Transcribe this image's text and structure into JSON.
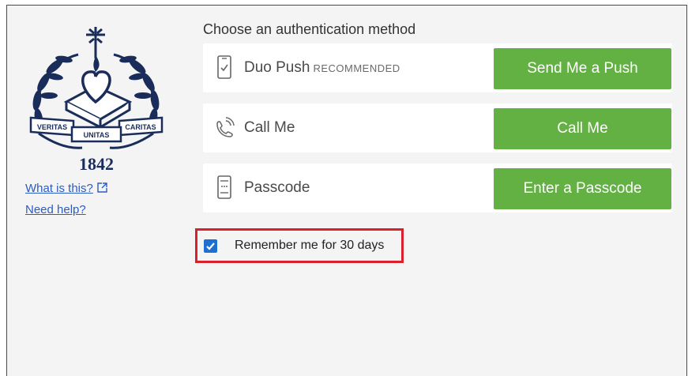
{
  "prompt": {
    "heading": "Choose an authentication method"
  },
  "logo": {
    "banner_left": "VERITAS",
    "banner_center": "UNITAS",
    "banner_right": "CARITAS",
    "year": "1842"
  },
  "side_links": {
    "what_is_this": "What is this?",
    "need_help": "Need help?"
  },
  "methods": [
    {
      "label": "Duo Push",
      "tag": "RECOMMENDED",
      "icon": "phone-push-icon",
      "button": "Send Me a Push"
    },
    {
      "label": "Call Me",
      "tag": "",
      "icon": "phone-call-icon",
      "button": "Call Me"
    },
    {
      "label": "Passcode",
      "tag": "",
      "icon": "passcode-device-icon",
      "button": "Enter a Passcode"
    }
  ],
  "remember": {
    "label": "Remember me for 30 days",
    "checked": true
  },
  "colors": {
    "button_green": "#63b043",
    "checkbox_blue": "#1f6fd0",
    "highlight_red": "#d9202b",
    "link_blue": "#2b5cc2",
    "logo_navy": "#1a2d5a"
  }
}
